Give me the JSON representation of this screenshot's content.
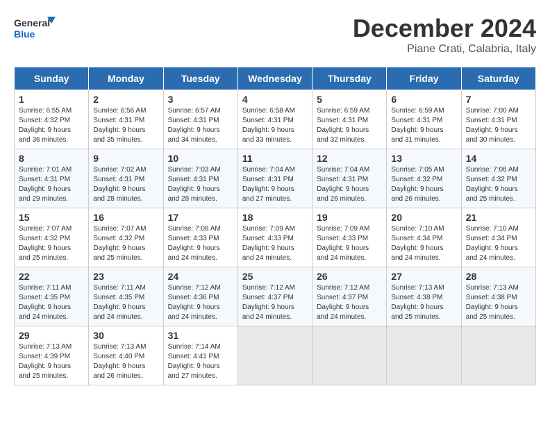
{
  "logo": {
    "line1": "General",
    "line2": "Blue"
  },
  "title": "December 2024",
  "subtitle": "Piane Crati, Calabria, Italy",
  "weekdays": [
    "Sunday",
    "Monday",
    "Tuesday",
    "Wednesday",
    "Thursday",
    "Friday",
    "Saturday"
  ],
  "weeks": [
    [
      {
        "day": "1",
        "info": "Sunrise: 6:55 AM\nSunset: 4:32 PM\nDaylight: 9 hours\nand 36 minutes."
      },
      {
        "day": "2",
        "info": "Sunrise: 6:56 AM\nSunset: 4:31 PM\nDaylight: 9 hours\nand 35 minutes."
      },
      {
        "day": "3",
        "info": "Sunrise: 6:57 AM\nSunset: 4:31 PM\nDaylight: 9 hours\nand 34 minutes."
      },
      {
        "day": "4",
        "info": "Sunrise: 6:58 AM\nSunset: 4:31 PM\nDaylight: 9 hours\nand 33 minutes."
      },
      {
        "day": "5",
        "info": "Sunrise: 6:59 AM\nSunset: 4:31 PM\nDaylight: 9 hours\nand 32 minutes."
      },
      {
        "day": "6",
        "info": "Sunrise: 6:59 AM\nSunset: 4:31 PM\nDaylight: 9 hours\nand 31 minutes."
      },
      {
        "day": "7",
        "info": "Sunrise: 7:00 AM\nSunset: 4:31 PM\nDaylight: 9 hours\nand 30 minutes."
      }
    ],
    [
      {
        "day": "8",
        "info": "Sunrise: 7:01 AM\nSunset: 4:31 PM\nDaylight: 9 hours\nand 29 minutes."
      },
      {
        "day": "9",
        "info": "Sunrise: 7:02 AM\nSunset: 4:31 PM\nDaylight: 9 hours\nand 28 minutes."
      },
      {
        "day": "10",
        "info": "Sunrise: 7:03 AM\nSunset: 4:31 PM\nDaylight: 9 hours\nand 28 minutes."
      },
      {
        "day": "11",
        "info": "Sunrise: 7:04 AM\nSunset: 4:31 PM\nDaylight: 9 hours\nand 27 minutes."
      },
      {
        "day": "12",
        "info": "Sunrise: 7:04 AM\nSunset: 4:31 PM\nDaylight: 9 hours\nand 26 minutes."
      },
      {
        "day": "13",
        "info": "Sunrise: 7:05 AM\nSunset: 4:32 PM\nDaylight: 9 hours\nand 26 minutes."
      },
      {
        "day": "14",
        "info": "Sunrise: 7:06 AM\nSunset: 4:32 PM\nDaylight: 9 hours\nand 25 minutes."
      }
    ],
    [
      {
        "day": "15",
        "info": "Sunrise: 7:07 AM\nSunset: 4:32 PM\nDaylight: 9 hours\nand 25 minutes."
      },
      {
        "day": "16",
        "info": "Sunrise: 7:07 AM\nSunset: 4:32 PM\nDaylight: 9 hours\nand 25 minutes."
      },
      {
        "day": "17",
        "info": "Sunrise: 7:08 AM\nSunset: 4:33 PM\nDaylight: 9 hours\nand 24 minutes."
      },
      {
        "day": "18",
        "info": "Sunrise: 7:09 AM\nSunset: 4:33 PM\nDaylight: 9 hours\nand 24 minutes."
      },
      {
        "day": "19",
        "info": "Sunrise: 7:09 AM\nSunset: 4:33 PM\nDaylight: 9 hours\nand 24 minutes."
      },
      {
        "day": "20",
        "info": "Sunrise: 7:10 AM\nSunset: 4:34 PM\nDaylight: 9 hours\nand 24 minutes."
      },
      {
        "day": "21",
        "info": "Sunrise: 7:10 AM\nSunset: 4:34 PM\nDaylight: 9 hours\nand 24 minutes."
      }
    ],
    [
      {
        "day": "22",
        "info": "Sunrise: 7:11 AM\nSunset: 4:35 PM\nDaylight: 9 hours\nand 24 minutes."
      },
      {
        "day": "23",
        "info": "Sunrise: 7:11 AM\nSunset: 4:35 PM\nDaylight: 9 hours\nand 24 minutes."
      },
      {
        "day": "24",
        "info": "Sunrise: 7:12 AM\nSunset: 4:36 PM\nDaylight: 9 hours\nand 24 minutes."
      },
      {
        "day": "25",
        "info": "Sunrise: 7:12 AM\nSunset: 4:37 PM\nDaylight: 9 hours\nand 24 minutes."
      },
      {
        "day": "26",
        "info": "Sunrise: 7:12 AM\nSunset: 4:37 PM\nDaylight: 9 hours\nand 24 minutes."
      },
      {
        "day": "27",
        "info": "Sunrise: 7:13 AM\nSunset: 4:38 PM\nDaylight: 9 hours\nand 25 minutes."
      },
      {
        "day": "28",
        "info": "Sunrise: 7:13 AM\nSunset: 4:38 PM\nDaylight: 9 hours\nand 25 minutes."
      }
    ],
    [
      {
        "day": "29",
        "info": "Sunrise: 7:13 AM\nSunset: 4:39 PM\nDaylight: 9 hours\nand 25 minutes."
      },
      {
        "day": "30",
        "info": "Sunrise: 7:13 AM\nSunset: 4:40 PM\nDaylight: 9 hours\nand 26 minutes."
      },
      {
        "day": "31",
        "info": "Sunrise: 7:14 AM\nSunset: 4:41 PM\nDaylight: 9 hours\nand 27 minutes."
      },
      {
        "day": "",
        "info": ""
      },
      {
        "day": "",
        "info": ""
      },
      {
        "day": "",
        "info": ""
      },
      {
        "day": "",
        "info": ""
      }
    ]
  ]
}
